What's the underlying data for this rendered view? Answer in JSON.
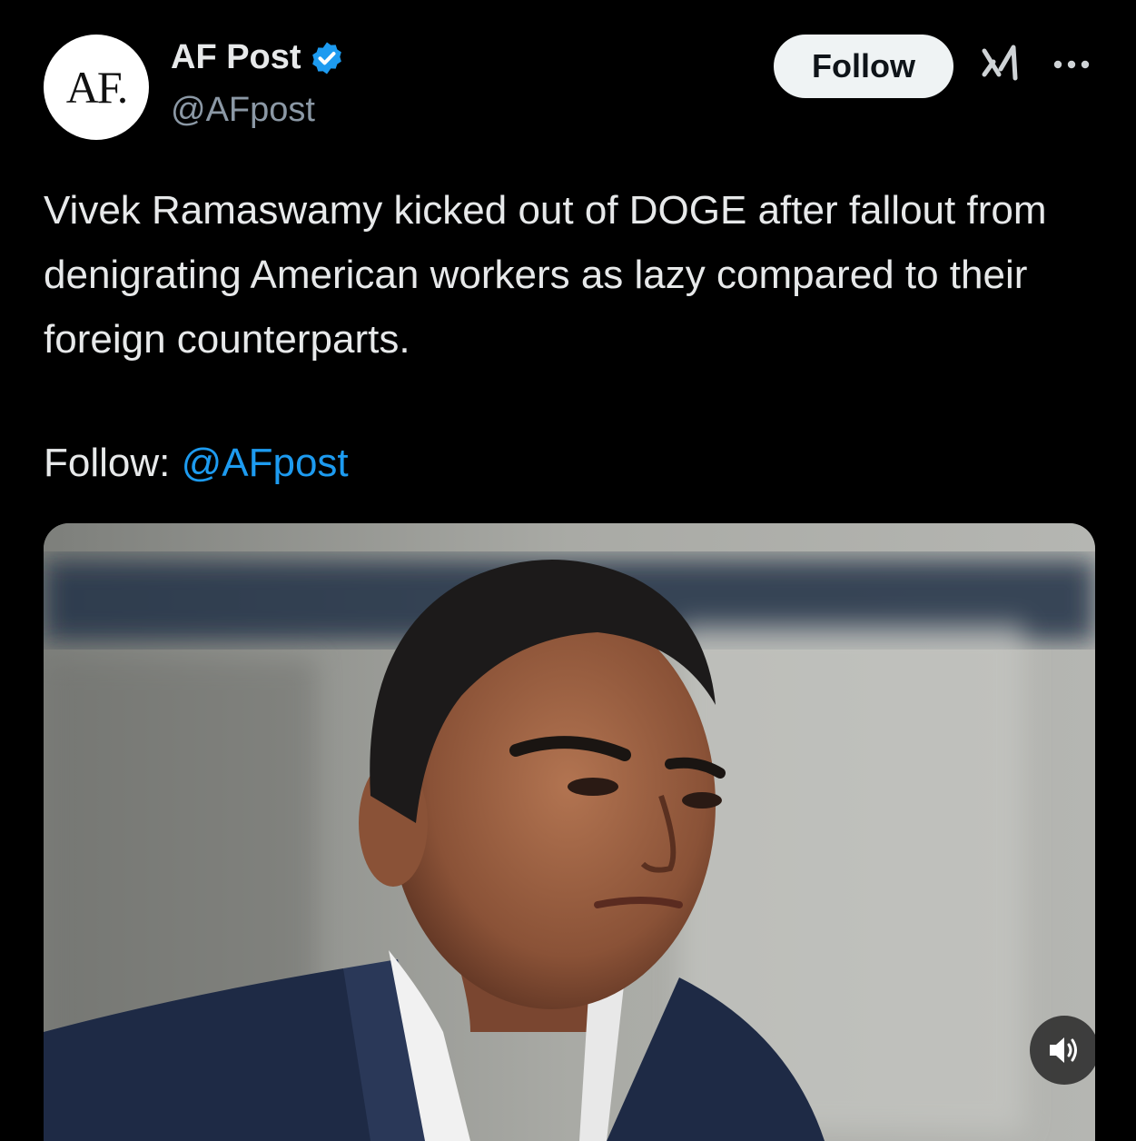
{
  "author": {
    "avatar_text": "AF.",
    "name": "AF Post",
    "handle": "@AFpost",
    "verified": true
  },
  "actions": {
    "follow_label": "Follow",
    "grok_icon": "grok-icon",
    "more_icon": "more-icon"
  },
  "post": {
    "text": "Vivek Ramaswamy kicked out of DOGE after fallout from denigrating American workers as lazy compared to their foreign counterparts.",
    "follow_prefix": "Follow: ",
    "follow_mention": "@AFpost"
  },
  "media": {
    "type": "video",
    "volume_icon": "volume-icon"
  },
  "colors": {
    "background": "#000000",
    "text": "#e7e9ea",
    "secondary": "#8b98a5",
    "accent": "#1d9bf0"
  }
}
